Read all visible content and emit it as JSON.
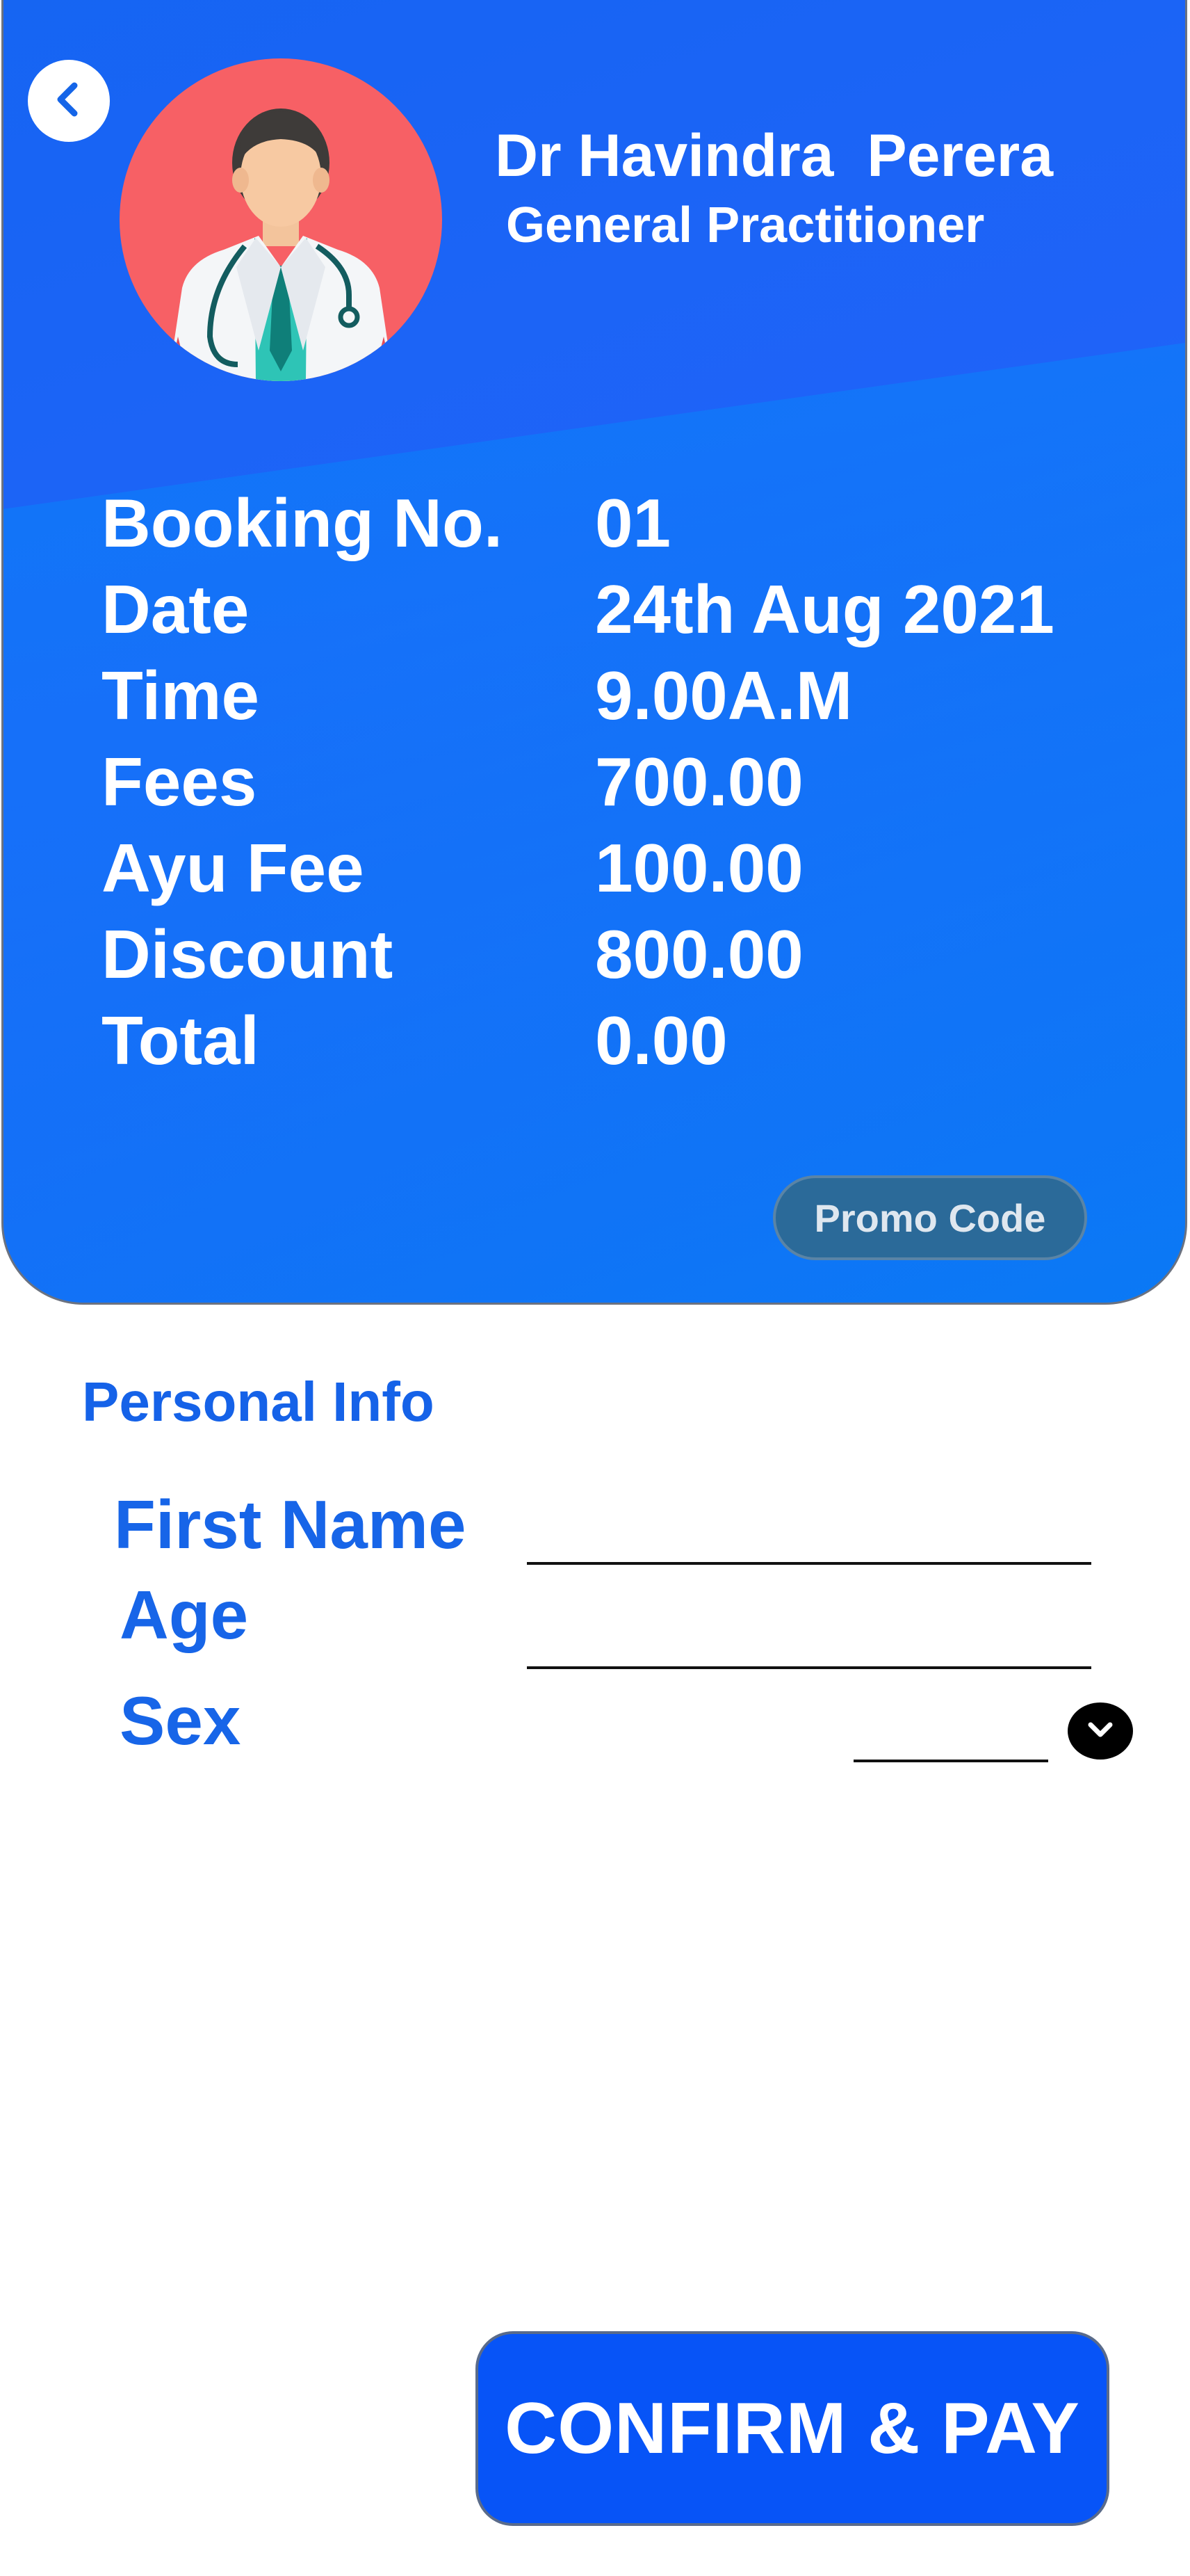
{
  "header": {
    "doctor_name": "Dr Havindra  Perera",
    "doctor_title": "General Practitioner",
    "back_icon": "chevron-left-icon",
    "avatar_icon": "doctor-avatar-icon",
    "colors": {
      "card_start": "#1565f2",
      "card_end": "#0a79f5",
      "avatar_bg": "#f76065"
    }
  },
  "booking": {
    "rows": [
      {
        "label": "Booking No.",
        "value": "01"
      },
      {
        "label": "Date",
        "value": "24th Aug 2021"
      },
      {
        "label": "Time",
        "value": "9.00A.M"
      },
      {
        "label": "Fees",
        "value": "700.00"
      },
      {
        "label": "Ayu Fee",
        "value": "100.00"
      },
      {
        "label": "Discount",
        "value": "800.00"
      },
      {
        "label": "Total",
        "value": "0.00"
      }
    ],
    "promo_label": "Promo Code"
  },
  "personal_info": {
    "title": "Personal Info",
    "first_name_label": "First Name",
    "first_name_value": "",
    "age_label": "Age",
    "age_value": "",
    "sex_label": "Sex",
    "sex_value": "",
    "dropdown_icon": "chevron-down-icon"
  },
  "actions": {
    "confirm_label": "CONFIRM & PAY",
    "accent_color": "#0754f7"
  }
}
